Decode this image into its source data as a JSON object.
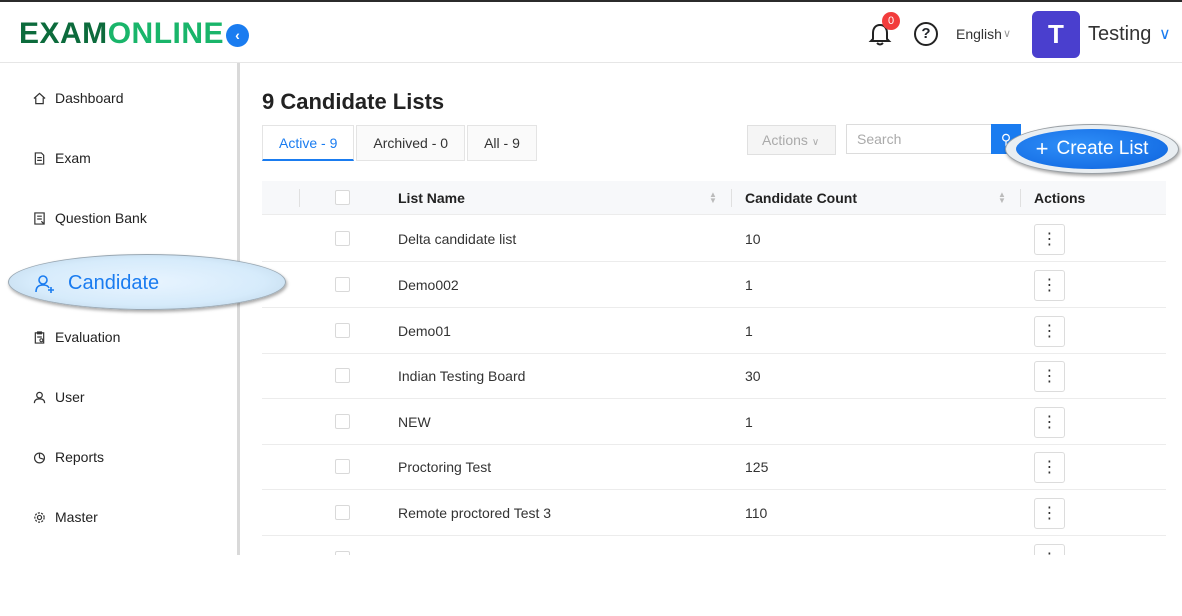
{
  "header": {
    "logo_part1": "EXAM",
    "logo_part2": "ONLINE",
    "notification_count": "0",
    "language": "English",
    "avatar_initial": "T",
    "username": "Testing"
  },
  "sidebar": {
    "items": [
      {
        "label": "Dashboard",
        "icon": "home-icon"
      },
      {
        "label": "Exam",
        "icon": "file-icon"
      },
      {
        "label": "Question Bank",
        "icon": "book-icon"
      },
      {
        "label": "Candidate",
        "icon": "users-icon"
      },
      {
        "label": "Evaluation",
        "icon": "clipboard-icon"
      },
      {
        "label": "User",
        "icon": "user-icon"
      },
      {
        "label": "Reports",
        "icon": "pie-chart-icon"
      },
      {
        "label": "Master",
        "icon": "gear-icon"
      }
    ]
  },
  "main": {
    "title": "9 Candidate Lists",
    "tabs": [
      {
        "label": "Active - 9"
      },
      {
        "label": "Archived - 0"
      },
      {
        "label": "All - 9"
      }
    ],
    "actions_label": "Actions",
    "search_placeholder": "Search",
    "create_label": "Create List",
    "table": {
      "columns": [
        "List Name",
        "Candidate Count",
        "Actions"
      ],
      "rows": [
        {
          "name": "Delta candidate list",
          "count": "10"
        },
        {
          "name": "Demo002",
          "count": "1"
        },
        {
          "name": "Demo01",
          "count": "1"
        },
        {
          "name": "Indian Testing Board",
          "count": "30"
        },
        {
          "name": "NEW",
          "count": "1"
        },
        {
          "name": "Proctoring Test",
          "count": "125"
        },
        {
          "name": "Remote proctored Test 3",
          "count": "110"
        },
        {
          "name": "",
          "count": ""
        }
      ]
    }
  },
  "colors": {
    "accent": "#1a7cf0",
    "logo_dark": "#0c6b3c",
    "logo_light": "#19b56a",
    "badge": "#f23c3c",
    "avatar": "#4a3fce"
  }
}
